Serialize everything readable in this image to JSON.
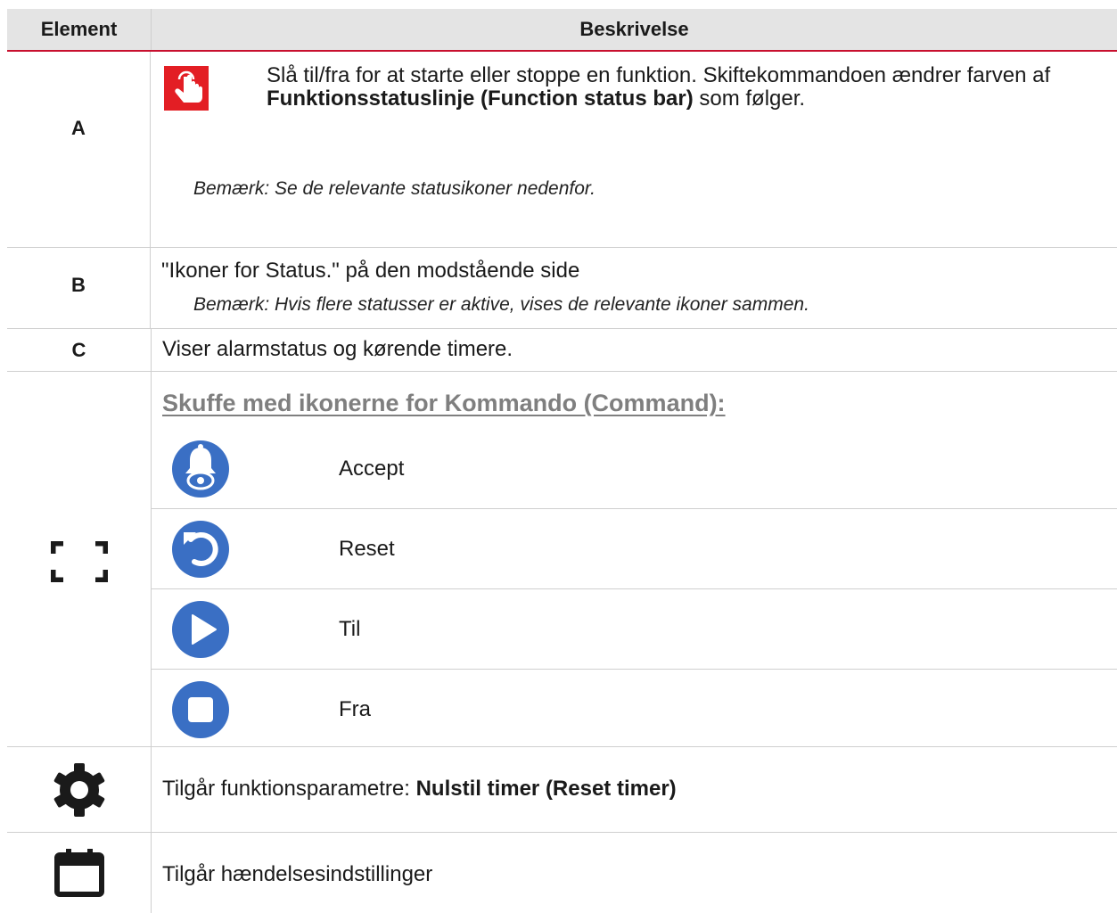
{
  "header": {
    "col1": "Element",
    "col2": "Beskrivelse"
  },
  "rows": {
    "a": {
      "element": "A",
      "text_before": "Slå til/fra for at starte eller stoppe en funktion. Skiftekommandoen ændrer farven af ",
      "text_bold": "Funktionsstatuslinje (Function status bar)",
      "text_after": " som følger.",
      "note": "Bemærk: Se de relevante statusikoner nedenfor.",
      "icon": "touch-toggle-icon",
      "icon_color": "#e31e24"
    },
    "b": {
      "element": "B",
      "text": "\"Ikoner for Status.\" på den modstående side",
      "note": "Bemærk: Hvis flere statusser er aktive, vises de relevante ikoner sammen."
    },
    "c": {
      "element": "C",
      "text": "Viser alarmstatus og kørende timere."
    },
    "drawer": {
      "element_icon": "expand-corners-icon",
      "title": "Skuffe med ikonerne for Kommando (Command):",
      "commands": [
        {
          "icon": "bell-eye-icon",
          "label": "Accept"
        },
        {
          "icon": "reset-arrow-icon",
          "label": "Reset"
        },
        {
          "icon": "play-icon",
          "label": "Til"
        },
        {
          "icon": "stop-icon",
          "label": "Fra"
        }
      ],
      "icon_color": "#3a6fc4"
    },
    "settings": {
      "element_icon": "gear-icon",
      "text_before": "Tilgår funktionsparametre: ",
      "text_bold": "Nulstil timer (Reset timer)"
    },
    "events": {
      "element_icon": "calendar-icon",
      "text": "Tilgår hændelsesindstillinger"
    }
  }
}
